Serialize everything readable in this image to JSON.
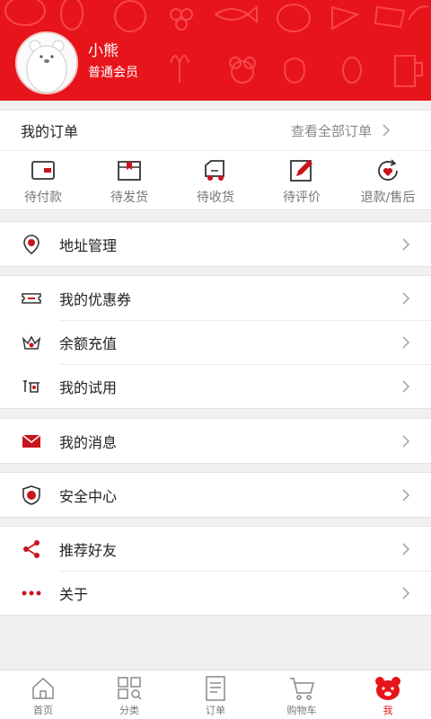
{
  "profile": {
    "username": "小熊",
    "member_level": "普通会员"
  },
  "orders": {
    "title": "我的订单",
    "view_all": "查看全部订单",
    "statuses": [
      {
        "label": "待付款",
        "icon": "wallet-icon"
      },
      {
        "label": "待发货",
        "icon": "box-icon"
      },
      {
        "label": "待收货",
        "icon": "truck-icon"
      },
      {
        "label": "待评价",
        "icon": "edit-icon"
      },
      {
        "label": "退款/售后",
        "icon": "refund-heart-icon"
      }
    ]
  },
  "menu": {
    "address": {
      "label": "地址管理",
      "icon": "location-pin-icon"
    },
    "coupons": {
      "label": "我的优惠券",
      "icon": "ticket-icon"
    },
    "recharge": {
      "label": "余额充值",
      "icon": "crown-icon"
    },
    "trial": {
      "label": "我的试用",
      "icon": "trial-icon"
    },
    "messages": {
      "label": "我的消息",
      "icon": "envelope-icon"
    },
    "security": {
      "label": "安全中心",
      "icon": "shield-icon"
    },
    "share": {
      "label": "推荐好友",
      "icon": "share-icon"
    },
    "about": {
      "label": "关于",
      "icon": "more-dots-icon"
    }
  },
  "tabbar": [
    {
      "label": "首页",
      "icon": "home-icon",
      "active": false
    },
    {
      "label": "分类",
      "icon": "category-icon",
      "active": false
    },
    {
      "label": "订单",
      "icon": "order-doc-icon",
      "active": false
    },
    {
      "label": "购物车",
      "icon": "cart-icon",
      "active": false
    },
    {
      "label": "我",
      "icon": "bear-icon",
      "active": true
    }
  ],
  "colors": {
    "brand_red": "#e8141c",
    "icon_red": "#c8141c",
    "background": "#f0f0f2"
  }
}
